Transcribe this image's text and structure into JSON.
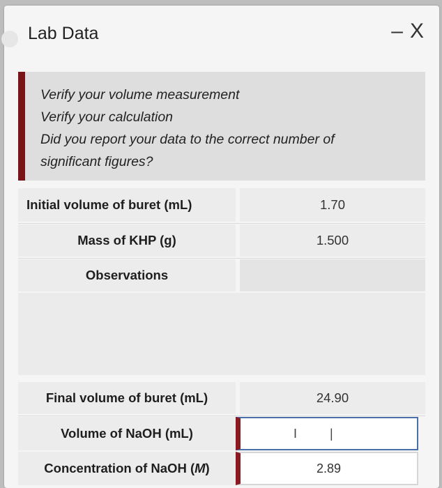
{
  "window": {
    "title": "Lab Data",
    "minimize_glyph": "–",
    "close_glyph": "X"
  },
  "feedback": {
    "accent_color": "#7a1219",
    "lines": [
      "Verify your volume measurement",
      "Verify your calculation",
      "Did you report your data to the correct number of",
      "significant figures?"
    ]
  },
  "rows": {
    "initial_volume": {
      "label": "Initial volume of buret (mL)",
      "value": "1.70"
    },
    "mass_khp": {
      "label": "Mass of KHP (g)",
      "value": "1.500"
    },
    "observations": {
      "label": "Observations"
    },
    "final_volume": {
      "label": "Final volume of buret (mL)",
      "value": "24.90"
    },
    "volume_naoh": {
      "label": "Volume of NaOH (mL)",
      "value": ""
    },
    "concentration": {
      "label_prefix": "Concentration of NaOH (",
      "label_unit": "M",
      "label_suffix": ")",
      "value": "2.89"
    }
  },
  "icons": {
    "text_cursor": "I",
    "caret": "|"
  }
}
